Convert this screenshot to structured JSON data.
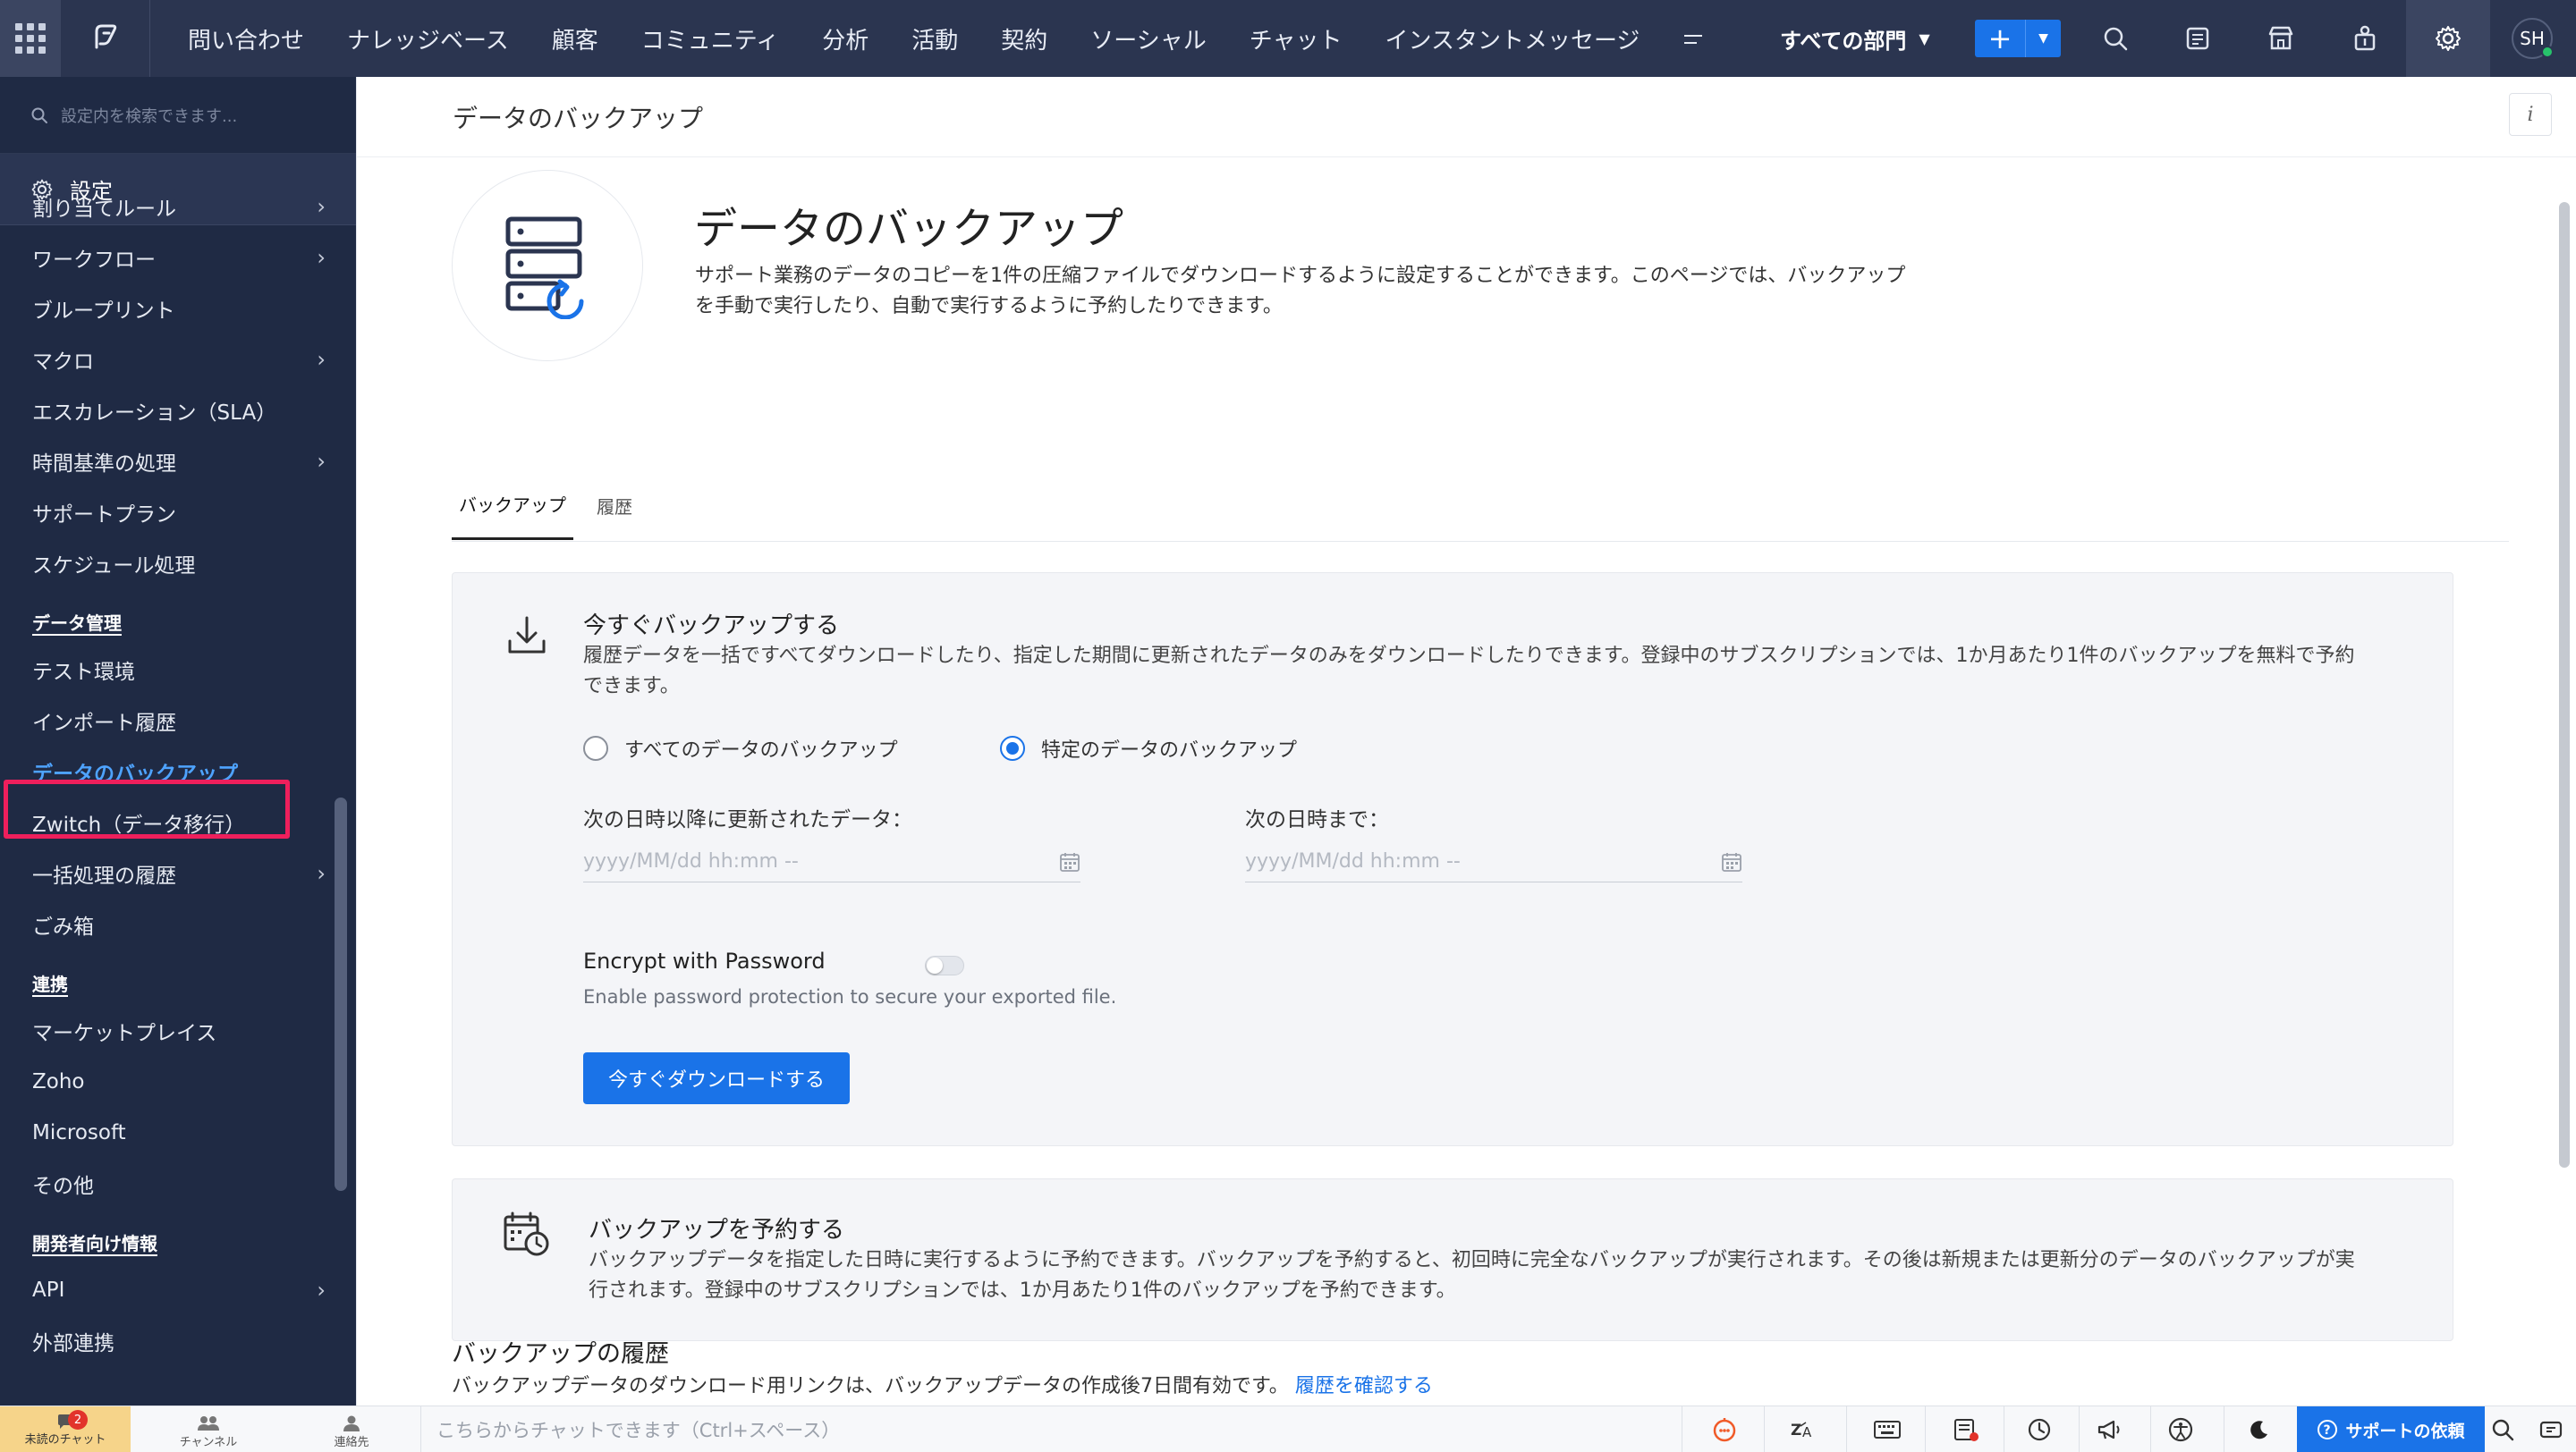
{
  "topbar": {
    "nav": [
      "問い合わせ",
      "ナレッジベース",
      "顧客",
      "コミュニティ",
      "分析",
      "活動",
      "契約",
      "ソーシャル",
      "チャット",
      "インスタントメッセージ"
    ],
    "department": "すべての部門",
    "avatar_initials": "SH"
  },
  "sidebar": {
    "search_placeholder": "設定内を検索できます...",
    "settings_label": "設定",
    "items_a": [
      {
        "label": "割り当てルール",
        "chevron": true
      },
      {
        "label": "ワークフロー",
        "chevron": true
      },
      {
        "label": "ブループリント",
        "chevron": false
      },
      {
        "label": "マクロ",
        "chevron": true
      },
      {
        "label": "エスカレーション（SLA）",
        "chevron": false
      },
      {
        "label": "時間基準の処理",
        "chevron": true
      },
      {
        "label": "サポートプラン",
        "chevron": false
      },
      {
        "label": "スケジュール処理",
        "chevron": false
      }
    ],
    "section_data": "データ管理",
    "items_b": [
      {
        "label": "テスト環境",
        "chevron": false
      },
      {
        "label": "インポート履歴",
        "chevron": false
      },
      {
        "label": "データのバックアップ",
        "chevron": false,
        "selected": true
      },
      {
        "label": "Zwitch（データ移行）",
        "chevron": false
      },
      {
        "label": "一括処理の履歴",
        "chevron": true
      },
      {
        "label": "ごみ箱",
        "chevron": false
      }
    ],
    "section_integrations": "連携",
    "items_c": [
      {
        "label": "マーケットプレイス",
        "chevron": false
      },
      {
        "label": "Zoho",
        "chevron": false
      },
      {
        "label": "Microsoft",
        "chevron": false
      },
      {
        "label": "その他",
        "chevron": false
      }
    ],
    "section_dev": "開発者向け情報",
    "items_d": [
      {
        "label": "API",
        "chevron": true
      },
      {
        "label": "外部連携",
        "chevron": false
      }
    ]
  },
  "page": {
    "breadcrumb": "データのバックアップ",
    "title": "データのバックアップ",
    "description": "サポート業務のデータのコピーを1件の圧縮ファイルでダウンロードするように設定することができます。このページでは、バックアップを手動で実行したり、自動で実行するように予約したりできます。",
    "tabs": [
      "バックアップ",
      "履歴"
    ]
  },
  "backup_now": {
    "title": "今すぐバックアップする",
    "description": "履歴データを一括ですべてダウンロードしたり、指定した期間に更新されたデータのみをダウンロードしたりできます。登録中のサブスクリプションでは、1か月あたり1件のバックアップを無料で予約できます。",
    "radio_all": "すべてのデータのバックアップ",
    "radio_specific": "特定のデータのバックアップ",
    "selected": "specific",
    "from_label": "次の日時以降に更新されたデータ：",
    "to_label": "次の日時まで：",
    "date_placeholder": "yyyy/MM/dd hh:mm --",
    "encrypt_label": "Encrypt with Password",
    "encrypt_enabled": false,
    "encrypt_help": "Enable password protection to secure your exported file.",
    "button": "今すぐダウンロードする"
  },
  "schedule": {
    "title": "バックアップを予約する",
    "description": "バックアップデータを指定した日時に実行するように予約できます。バックアップを予約すると、初回時に完全なバックアップが実行されます。その後は新規または更新分のデータのバックアップが実行されます。登録中のサブスクリプションでは、1か月あたり1件のバックアップを予約できます。"
  },
  "history": {
    "title": "バックアップの履歴",
    "description": "バックアップデータのダウンロード用リンクは、バックアップデータの作成後7日間有効です。",
    "link": "履歴を確認する"
  },
  "bottombar": {
    "unread_label": "未読のチャット",
    "unread_count": "2",
    "channels_label": "チャンネル",
    "contacts_label": "連絡先",
    "chat_placeholder": "こちらからチャットできます（Ctrl+スペース）",
    "support_label": "サポートの依頼"
  },
  "colors": {
    "topbar": "#2b3550",
    "sidebar": "#1f2a44",
    "accent": "#1a73e8",
    "highlight": "#ee1f5c"
  }
}
